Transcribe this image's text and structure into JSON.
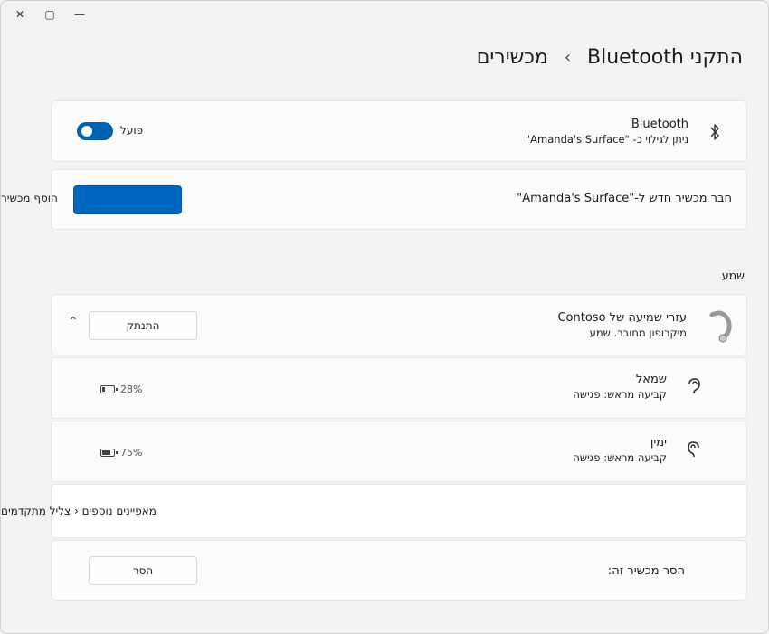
{
  "window": {
    "close_icon": "✕",
    "maximize_icon": "▢",
    "minimize_icon": "—"
  },
  "breadcrumb": {
    "parent": "התקני Bluetooth",
    "separator": "›",
    "current": "מכשירים"
  },
  "bluetooth": {
    "title": "Bluetooth",
    "subtitle": "ניתן לגילוי כ- \"Amanda's Surface\"",
    "toggle_label": "פועל",
    "toggle_on": true,
    "icon": "bluetooth-icon",
    "accent": "#0063b1"
  },
  "add_device": {
    "label": "חבר מכשיר חדש ל-\"Amanda's Surface\"",
    "overflow_label": "הוסף מכשיר",
    "button_color": "#0067c0"
  },
  "hearing": {
    "section_label": "שמע",
    "device_name": "עזרי שמיעה של Contoso",
    "device_status": "מיקרופון מחובר. שמע",
    "connect_button": "התנתק",
    "expand_icon": "⌃",
    "left": {
      "name": "שמאל",
      "preset": "קביעה מראש: פגישה",
      "battery": "28%",
      "battery_level": 0.28
    },
    "right": {
      "name": "ימין",
      "preset": "קביעה מראש: פגישה",
      "battery": "75%",
      "battery_level": 0.75
    },
    "advanced": "מאפיינים נוספים ‹ צליל מתקדמים",
    "remove_label": "הסר מכשיר זה:",
    "remove_button": "הסר"
  }
}
